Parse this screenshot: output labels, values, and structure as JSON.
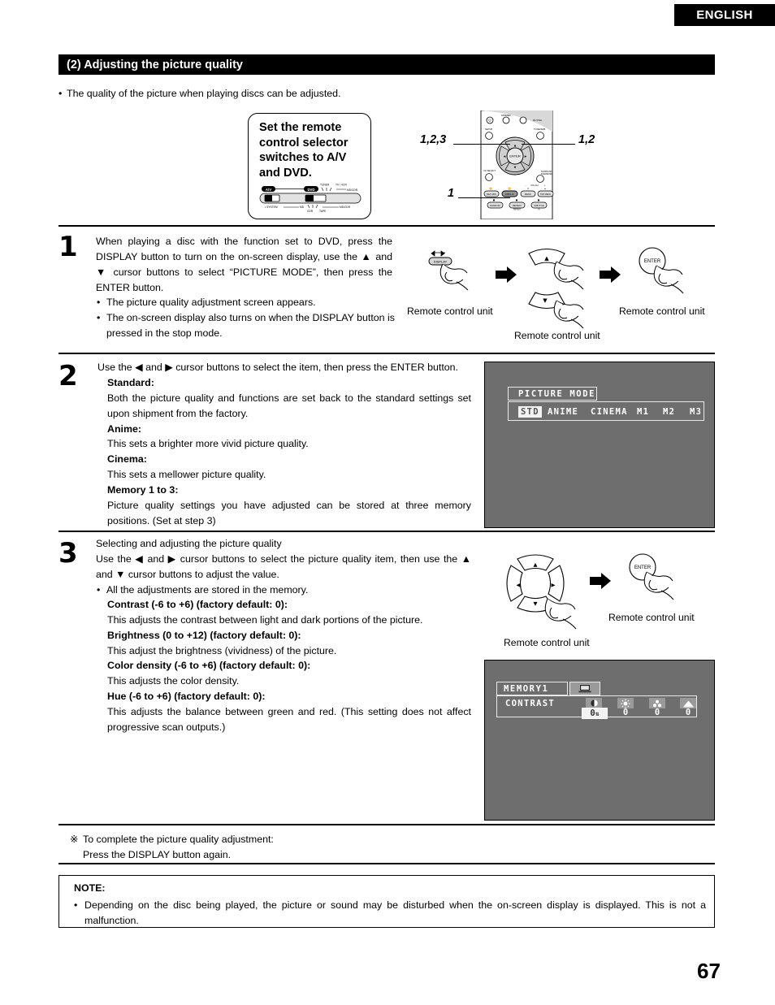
{
  "header": {
    "language_tab": "ENGLISH",
    "section_title": "(2) Adjusting the picture quality",
    "intro": "The quality of the picture when playing discs can be adjusted."
  },
  "callout": {
    "text": "Set the remote control selector switches to A/V and DVD.",
    "switch_labels": {
      "av": "A/V",
      "dvd": "DVD",
      "tuner": "TUNER",
      "tv_vcr": "TV / VCR",
      "mdcdr_right": "MD/CDR",
      "system": "SYSTEM",
      "md": "MD",
      "cdr": "CDR",
      "tape": "TAPE",
      "mdcdr_bottom": "MD/CDR"
    }
  },
  "remote_callouts": {
    "left_top": "1,2,3",
    "right_top": "1,2",
    "left_bottom": "1"
  },
  "remote_keys": {
    "power": "POWER",
    "dimmer": "DIMMER",
    "setup": "SETUP",
    "muting": "MUTING",
    "tone_sdb": "TONE/SDB",
    "enter": "ENTER",
    "ch_select": "CH SELECT",
    "surround_parameter": "SURROUND PARAMETER",
    "return": "RETURN",
    "display": "DISPLAY",
    "menu": "MENU",
    "top_menu": "TOP MENU",
    "random": "RANDOM",
    "repeat": "REPEAT",
    "sub_title": "SUB TITLE",
    "vol_ch": "VOL CH"
  },
  "steps": [
    {
      "number": "1",
      "paragraphs": [
        "When playing a disc with the function set to DVD, press the DISPLAY button to turn on the on-screen display, use the ▲ and ▼ cursor buttons to select “PICTURE MODE”, then press the ENTER button."
      ],
      "bullets": [
        "The picture quality adjustment screen appears.",
        "The on-screen display also turns on when the DISPLAY button is pressed in the stop mode."
      ],
      "captions": [
        "Remote control unit",
        "Remote control unit",
        "Remote control unit"
      ],
      "button_labels": {
        "display": "DISPLAY",
        "up": "▲",
        "down": "▼",
        "enter": "ENTER"
      }
    },
    {
      "number": "2",
      "lead": "Use the ◀ and ▶ cursor buttons to select the item, then press the ENTER button.",
      "items": [
        {
          "title": "Standard:",
          "desc": "Both the picture quality and functions are set back to the standard settings set upon shipment from the factory."
        },
        {
          "title": "Anime:",
          "desc": "This sets a brighter more vivid picture quality."
        },
        {
          "title": "Cinema:",
          "desc": "This sets a mellower picture quality."
        },
        {
          "title": "Memory 1 to 3:",
          "desc": "Picture quality settings you have adjusted can be stored at three memory positions. (Set at step 3)"
        }
      ]
    },
    {
      "number": "3",
      "lead1": "Selecting and adjusting the picture quality",
      "lead2": "Use the ◀ and ▶ cursor buttons to select the picture quality item, then use the ▲ and ▼ cursor buttons to adjust the value.",
      "bullet": "All the adjustments are stored in the memory.",
      "items": [
        {
          "title": "Contrast (-6 to +6) (factory default: 0):",
          "desc": "This adjusts the contrast between light and dark portions of the picture."
        },
        {
          "title": "Brightness (0 to +12) (factory default: 0):",
          "desc": "This adjust the brightness (vividness) of the picture."
        },
        {
          "title": "Color density (-6 to +6) (factory default: 0):",
          "desc": "This adjusts the color density."
        },
        {
          "title": "Hue (-6 to +6) (factory default: 0):",
          "desc": "This adjusts the balance between green and red. (This setting does not affect progressive scan outputs.)"
        }
      ],
      "captions": [
        "Remote control unit",
        "Remote control unit"
      ],
      "button_labels": {
        "enter": "ENTER",
        "up": "▲",
        "down": "▼",
        "left": "◀",
        "right": "▶"
      }
    }
  ],
  "osd_picture_mode": {
    "title": "PICTURE MODE",
    "options": [
      "STD",
      "ANIME",
      "CINEMA",
      "M1",
      "M2",
      "M3"
    ],
    "selected": "STD"
  },
  "osd_memory": {
    "title": "MEMORY1",
    "row_label": "CONTRAST",
    "icons": [
      "contrast-icon",
      "brightness-icon",
      "color-density-icon",
      "hue-icon"
    ],
    "values": [
      "0",
      "0",
      "0",
      "0"
    ],
    "active_index": 0,
    "tv_icon": "tv-screen-icon"
  },
  "star_note": {
    "line1": "To complete the picture quality adjustment:",
    "line2": "Press the DISPLAY button again.",
    "marker": "※"
  },
  "note": {
    "title": "NOTE:",
    "body": "Depending on the disc being played, the picture or sound may be disturbed when the on-screen display is displayed. This is not a malfunction."
  },
  "page_number": "67",
  "colors": {
    "bar": "#000000",
    "osd_bg": "#6e6e6e",
    "osd_border": "#e8e8e8",
    "icon_box": "#9a9a9a"
  }
}
